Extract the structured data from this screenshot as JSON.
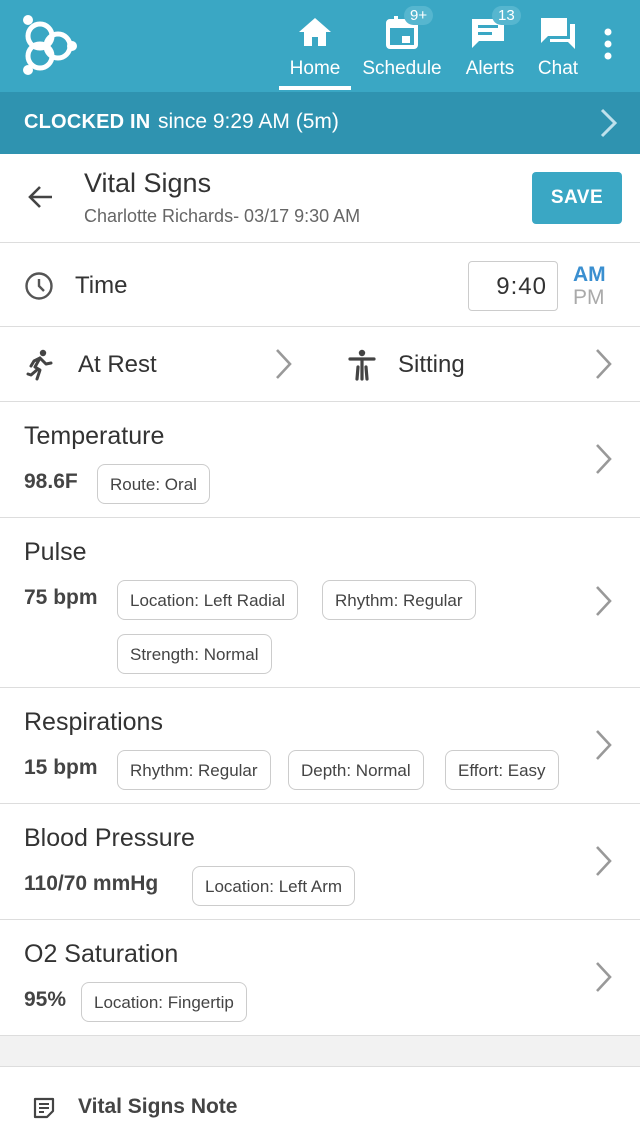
{
  "nav": {
    "items": [
      {
        "label": "Home",
        "icon": "home-icon"
      },
      {
        "label": "Schedule",
        "icon": "calendar-icon",
        "badge": "9+"
      },
      {
        "label": "Alerts",
        "icon": "alerts-icon",
        "badge": "13"
      },
      {
        "label": "Chat",
        "icon": "chat-icon"
      }
    ],
    "active": "Home"
  },
  "clock_status": {
    "status": "CLOCKED IN",
    "since": "since 9:29 AM (5m)"
  },
  "header": {
    "title": "Vital Signs",
    "subtitle": "Charlotte Richards- 03/17 9:30 AM",
    "save_label": "SAVE"
  },
  "time": {
    "label": "Time",
    "value": "9:40",
    "am": "AM",
    "pm": "PM",
    "selected_period": "AM"
  },
  "position": {
    "activity": "At Rest",
    "posture": "Sitting"
  },
  "vitals": {
    "temperature": {
      "title": "Temperature",
      "value": "98.6F",
      "chips": [
        "Route: Oral"
      ]
    },
    "pulse": {
      "title": "Pulse",
      "value": "75 bpm",
      "chips": [
        "Location: Left Radial",
        "Rhythm: Regular",
        "Strength: Normal"
      ]
    },
    "respirations": {
      "title": "Respirations",
      "value": "15 bpm",
      "chips": [
        "Rhythm: Regular",
        "Depth: Normal",
        "Effort: Easy"
      ]
    },
    "blood_pressure": {
      "title": "Blood Pressure",
      "value": "110/70 mmHg",
      "chips": [
        "Location: Left Arm"
      ]
    },
    "o2": {
      "title": "O2 Saturation",
      "value": "95%",
      "chips": [
        "Location: Fingertip"
      ]
    }
  },
  "note": {
    "label": "Vital Signs Note"
  },
  "colors": {
    "topbar": "#3aa7c4",
    "clockbar": "#2f93b0",
    "accent": "#3a8fd0",
    "save": "#3aa7c4"
  }
}
